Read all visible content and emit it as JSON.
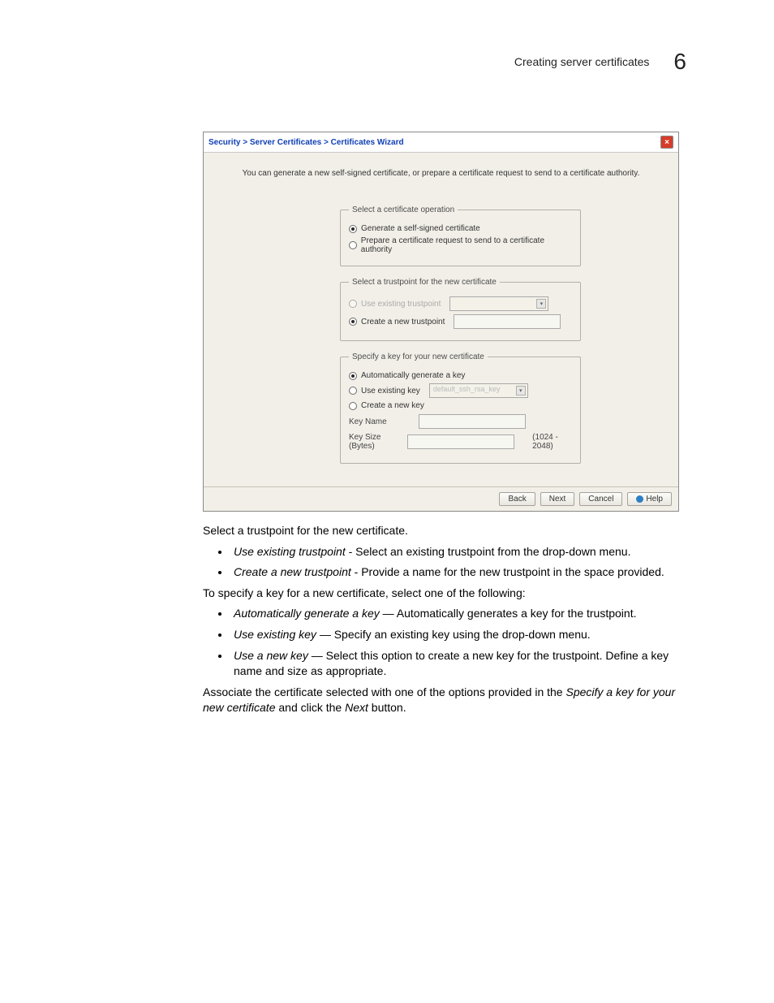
{
  "header": {
    "title": "Creating server certificates",
    "chapter": "6"
  },
  "wizard": {
    "breadcrumb": "Security > Server Certificates > Certificates Wizard",
    "intro": "You can generate a new self-signed certificate, or prepare a certificate request to send to a certificate authority.",
    "group1": {
      "legend": "Select a certificate operation",
      "opt1": "Generate a self-signed certificate",
      "opt2": "Prepare a certificate request to send to a certificate authority"
    },
    "group2": {
      "legend": "Select a trustpoint for the new certificate",
      "opt1": "Use existing trustpoint",
      "opt2": "Create a new trustpoint"
    },
    "group3": {
      "legend": "Specify a key for your new certificate",
      "opt1": "Automatically generate a  key",
      "opt2": "Use existing key",
      "select_value": "default_ssh_rsa_key",
      "opt3": "Create a new key",
      "key_name_label": "Key Name",
      "key_size_label": "Key Size (Bytes)",
      "key_size_hint": "(1024 - 2048)"
    },
    "footer": {
      "back": "Back",
      "next": "Next",
      "cancel": "Cancel",
      "help": "Help"
    }
  },
  "body": {
    "p1": "Select a trustpoint for the new certificate.",
    "li1a": "Use existing trustpoint",
    "li1b": " - Select an existing trustpoint from the drop‑down menu.",
    "li2a": "Create a new trustpoint",
    "li2b": " - Provide a name for the new trustpoint in the space provided.",
    "p2": "To specify a key for a new certificate, select one of the following:",
    "li3a": "Automatically generate a key",
    "li3b": " — Automatically generates a key for the trustpoint.",
    "li4a": "Use existing key",
    "li4b": " — Specify an existing key using the drop‑down menu.",
    "li5a": "Use a new key",
    "li5b": " — Select this option to create a new key for the trustpoint. Define a key name and size as appropriate.",
    "p3a": "Associate the certificate selected with one of the options provided in the ",
    "p3b": "Specify a key for your new certificate",
    "p3c": " and click the ",
    "p3d": "Next",
    "p3e": " button."
  }
}
